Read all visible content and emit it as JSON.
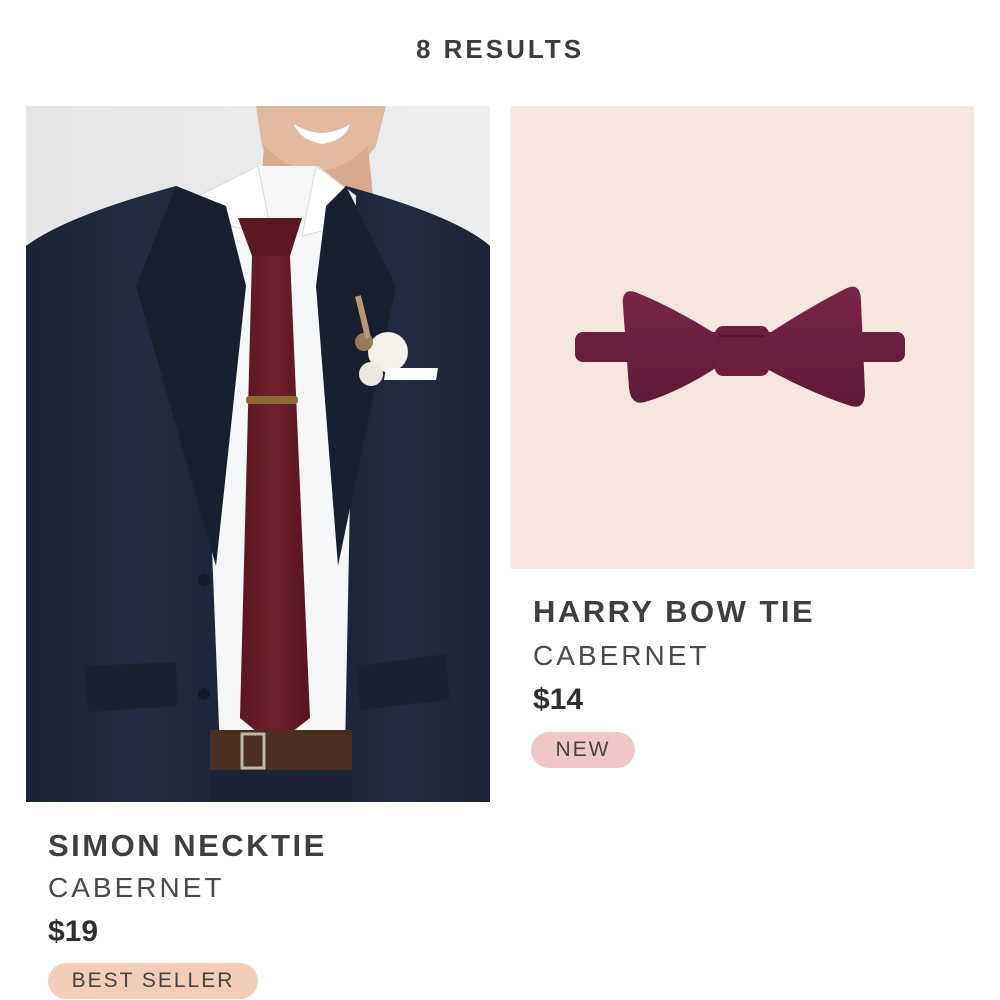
{
  "header": {
    "results_label": "8 RESULTS"
  },
  "products": [
    {
      "name": "SIMON NECKTIE",
      "color": "CABERNET",
      "price": "$19",
      "badge": "BEST SELLER",
      "badge_color": "#f2cdb7"
    },
    {
      "name": "HARRY BOW TIE",
      "color": "CABERNET",
      "price": "$14",
      "badge": "NEW",
      "badge_color": "#efc7c7"
    }
  ],
  "colors": {
    "cabernet": "#6b1f2a",
    "bowtie_plum": "#6e1f3f",
    "suit_navy": "#1e2839",
    "bowtie_background": "#f7e6df"
  }
}
